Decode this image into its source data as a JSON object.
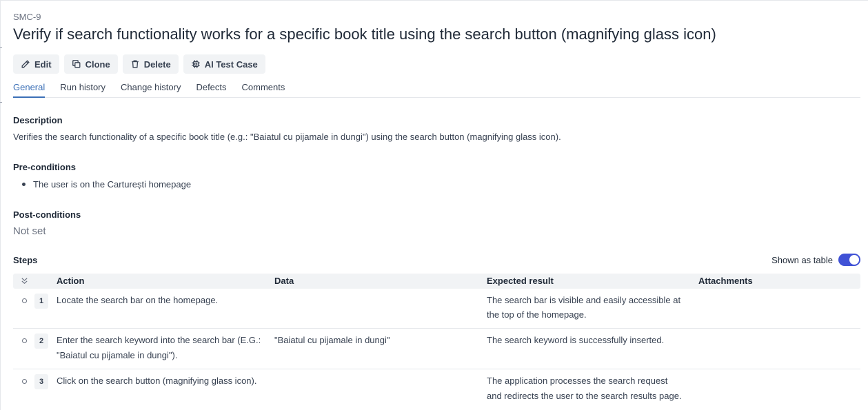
{
  "case": {
    "id": "SMC-9",
    "title": "Verify if search functionality works for a specific book title using the search button (magnifying glass icon)"
  },
  "toolbar": {
    "edit": "Edit",
    "clone": "Clone",
    "delete": "Delete",
    "ai": "AI Test Case"
  },
  "tabs": [
    "General",
    "Run history",
    "Change history",
    "Defects",
    "Comments"
  ],
  "description": {
    "label": "Description",
    "text": "Verifies the search functionality of a specific book title (e.g.: \"Baiatul cu pijamale in dungi\") using the search button (magnifying glass icon)."
  },
  "preconditions": {
    "label": "Pre-conditions",
    "items": [
      "The user is on the Carturești homepage"
    ]
  },
  "postconditions": {
    "label": "Post-conditions",
    "value": "Not set"
  },
  "steps": {
    "label": "Steps",
    "toggle_label": "Shown as table",
    "toggle_on": true,
    "columns": [
      "Action",
      "Data",
      "Expected result",
      "Attachments"
    ],
    "rows": [
      {
        "num": "1",
        "action_lines": [
          "Locate the search bar on the homepage."
        ],
        "data": "",
        "expected_lines": [
          "The search bar is visible and easily accessible at",
          "the top of the homepage."
        ]
      },
      {
        "num": "2",
        "action_lines": [
          "Enter the search keyword into the search bar (E.G.:",
          "\"Baiatul cu pijamale in dungi\")."
        ],
        "data": "\"Baiatul cu pijamale in dungi\"",
        "expected_lines": [
          "The search keyword is successfully inserted."
        ]
      },
      {
        "num": "3",
        "action_lines": [
          "Click on the search button (magnifying glass icon)."
        ],
        "data": "",
        "expected_lines": [
          "The application processes the search request",
          "and redirects the user to the search results page."
        ]
      }
    ]
  },
  "colors": {
    "accent": "#3b6fb6",
    "toggle": "#4052d6"
  }
}
